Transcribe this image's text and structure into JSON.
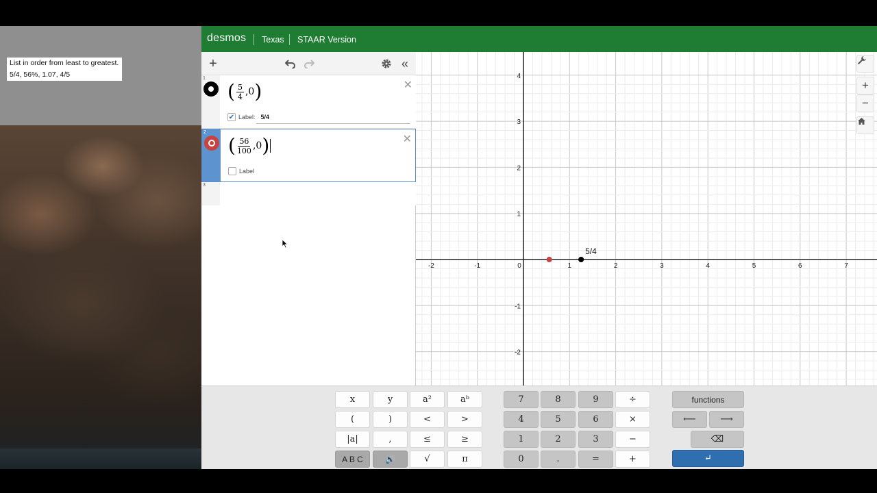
{
  "note": {
    "line1": "List in order from least to greatest.",
    "line2": "5/4, 56%, 1.07, 4/5"
  },
  "topbar": {
    "brand": "desmos",
    "crumb1": "Texas",
    "crumb2": "STAAR Version"
  },
  "toolbar": {
    "add_icon": "plus-icon",
    "undo_icon": "undo-icon",
    "redo_icon": "redo-icon",
    "settings_icon": "gear-icon",
    "collapse_icon": "double-chevron-left-icon"
  },
  "expressions": [
    {
      "num": "1",
      "color": "#000000",
      "numerator": "5",
      "denominator": "4",
      "y": "0",
      "label_text": "Label:",
      "label_checked": true,
      "label_value": "5/4"
    },
    {
      "num": "2",
      "color": "#c74440",
      "numerator": "56",
      "denominator": "100",
      "y": "0",
      "label_text": "Label",
      "label_checked": false,
      "label_value": ""
    },
    {
      "num": "3"
    }
  ],
  "graph": {
    "x_ticks": [
      "-2",
      "-1",
      "0",
      "1",
      "2",
      "3",
      "4",
      "5",
      "6",
      "7"
    ],
    "y_ticks": [
      "4",
      "3",
      "2",
      "1",
      "-1",
      "-2"
    ],
    "points": [
      {
        "x": 1.25,
        "y": 0,
        "color": "#000000",
        "label": "5/4"
      },
      {
        "x": 0.56,
        "y": 0,
        "color": "#c74440",
        "label": ""
      }
    ],
    "side_icons": [
      "wrench-icon",
      "zoom-in-icon",
      "zoom-out-icon",
      "home-icon"
    ]
  },
  "keypad": {
    "vars": [
      "x",
      "y",
      "a²",
      "aᵇ",
      "(",
      ")",
      "<",
      ">",
      "|a|",
      ",",
      "≤",
      "≥",
      "A B C",
      "🔊",
      "√",
      "π"
    ],
    "nums": [
      "7",
      "8",
      "9",
      "÷",
      "4",
      "5",
      "6",
      "×",
      "1",
      "2",
      "3",
      "−",
      "0",
      ".",
      "=",
      "+"
    ],
    "functions": "functions",
    "left_arrow": "⟵",
    "right_arrow": "⟶",
    "backspace": "⌫",
    "enter": "↵"
  }
}
